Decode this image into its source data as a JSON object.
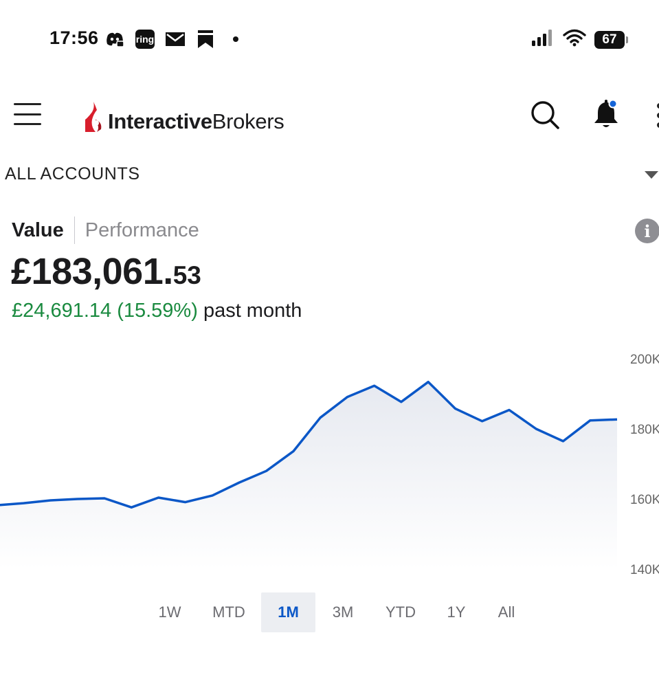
{
  "status_bar": {
    "time": "17:56",
    "notification_icons": [
      "discord-icon",
      "ring-icon",
      "mail-icon",
      "bookmark-icon",
      "dot-icon"
    ],
    "ring_label": "ring",
    "battery": "67",
    "signal_icon": "signal-icon",
    "wifi_icon": "wifi-icon"
  },
  "header": {
    "brand_bold": "Interactive",
    "brand_light": "Brokers",
    "brand_color": "#d81e2c",
    "icons": [
      "menu-icon",
      "search-icon",
      "bell-icon",
      "more-vertical-icon"
    ],
    "notification_dot_color": "#1565d8"
  },
  "account_selector": {
    "label": "ALL ACCOUNTS"
  },
  "view_toggle": {
    "value_label": "Value",
    "performance_label": "Performance",
    "selected": "Value",
    "info_glyph": "i"
  },
  "balance": {
    "main": "£183,061.",
    "cents": "53"
  },
  "change": {
    "amount": "£24,691.14 (15.59%)",
    "period": "past month",
    "color": "#1a8a3f"
  },
  "chart_data": {
    "type": "area",
    "series": [
      {
        "values": [
          158.2,
          158.8,
          159.6,
          160.0,
          160.2,
          157.6,
          160.4,
          159.1,
          161.0,
          164.7,
          168.0,
          173.6,
          183.2,
          189.1,
          192.3,
          187.7,
          193.4,
          185.8,
          182.2,
          185.4,
          180.0,
          176.5,
          182.4,
          182.7
        ]
      }
    ],
    "y_ticks": [
      "200K",
      "180K",
      "160K",
      "140K"
    ],
    "y_tick_values": [
      200,
      180,
      160,
      140
    ],
    "ylim": [
      140,
      200
    ],
    "line_color": "#0b57c7",
    "fill_color": "#eceef3",
    "grid": false
  },
  "range_tabs": {
    "items": [
      "1W",
      "MTD",
      "1M",
      "3M",
      "YTD",
      "1Y",
      "All"
    ],
    "active": "1M"
  }
}
